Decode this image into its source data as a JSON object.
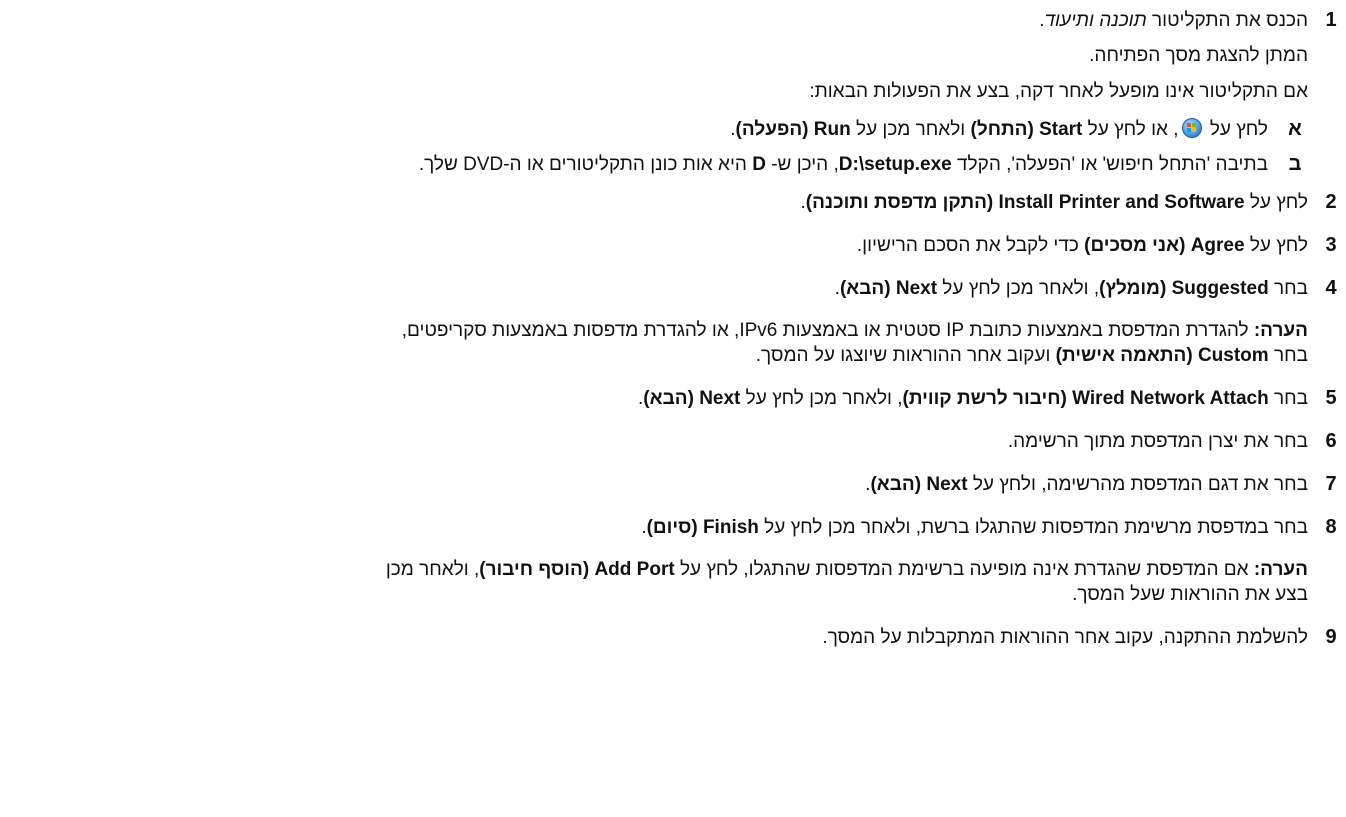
{
  "steps": [
    {
      "num": "1",
      "parts": {
        "a": "הכנס את התקליטור ",
        "b": "תוכנה ותיעוד",
        "c": "."
      },
      "lines": [
        "המתן להצגת מסך הפתיחה.",
        "אם התקליטור אינו מופעל לאחר דקה, בצע את הפעולות הבאות:"
      ],
      "substeps": [
        {
          "letter": "א",
          "parts": {
            "a": "לחץ על ",
            "b": ", או לחץ על ",
            "c": "Start",
            "d": " (התחל)",
            "e": " ולאחר מכן על ",
            "f": "Run",
            "g": " (הפעלה)",
            "h": "."
          },
          "icon": "windows-start-icon"
        },
        {
          "letter": "ב",
          "parts": {
            "a": "בתיבה 'התחל חיפוש' או 'הפעלה', הקלד ",
            "b": "D:\\setup.exe",
            "c": ", היכן ש- ",
            "d": "D",
            "e": " היא אות כונן התקליטורים או ה-DVD שלך."
          }
        }
      ]
    },
    {
      "num": "2",
      "parts": {
        "a": "לחץ על ",
        "b": "Install Printer and Software",
        "c": " (התקן מדפסת ותוכנה)",
        "d": "."
      }
    },
    {
      "num": "3",
      "parts": {
        "a": "לחץ על ",
        "b": "Agree",
        "c": " (אני מסכים)",
        "d": " כדי לקבל את הסכם הרישיון."
      }
    },
    {
      "num": "4",
      "parts": {
        "a": "בחר ",
        "b": "Suggested",
        "c": " (מומלץ)",
        "d": ", ולאחר מכן לחץ על ",
        "e": "Next",
        "f": " (הבא)",
        "g": "."
      }
    },
    {
      "num": "5",
      "parts": {
        "a": "בחר ",
        "b": "Wired Network Attach",
        "c": " (חיבור לרשת קווית)",
        "d": ", ולאחר מכן לחץ על ",
        "e": "Next",
        "f": " (הבא)",
        "g": "."
      }
    },
    {
      "num": "6",
      "parts": {
        "a": "בחר את יצרן המדפסת מתוך הרשימה."
      }
    },
    {
      "num": "7",
      "parts": {
        "a": "בחר את דגם המדפסת מהרשימה, ולחץ על ",
        "b": "Next",
        "c": " (הבא)",
        "d": "."
      }
    },
    {
      "num": "8",
      "parts": {
        "a": "בחר במדפסת מרשימת המדפסות שהתגלו ברשת, ולאחר מכן לחץ על ",
        "b": "Finish",
        "c": " (סיום)",
        "d": "."
      }
    },
    {
      "num": "9",
      "parts": {
        "a": "להשלמת ההתקנה, עקוב אחר ההוראות המתקבלות על המסך."
      }
    }
  ],
  "notes": [
    {
      "label": "הערה:",
      "line1": " להגדרת המדפסת באמצעות כתובת IP סטטית או באמצעות IPv6, או להגדרת מדפסות באמצעות סקריפטים,",
      "line2": {
        "a": "בחר ",
        "b": "Custom",
        "c": " (התאמה אישית)",
        "d": " ועקוב אחר ההוראות שיוצגו על המסך."
      }
    },
    {
      "label": "הערה:",
      "line1": {
        "a": " אם המדפסת שהגדרת אינה מופיעה ברשימת המדפסות שהתגלו, לחץ על ",
        "b": "Add Port",
        "c": " (הוסף חיבור)",
        "d": ", ולאחר מכן"
      },
      "line2": "בצע את ההוראות שעל המסך."
    }
  ]
}
